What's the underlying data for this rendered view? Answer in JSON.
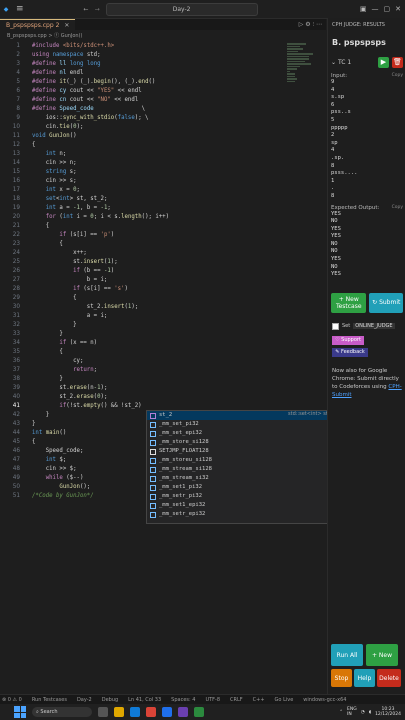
{
  "titlebar": {
    "search": "Day-2",
    "menu": "≡",
    "nav_back": "←",
    "nav_fwd": "→"
  },
  "tabs": [
    {
      "label": "B_pspspsps.cpp 2"
    }
  ],
  "breadcrumb": "B_pspspsps.cpp > ⓕ GunJon()",
  "code_lines": [
    {
      "n": "1",
      "html": "<span class='kw'>#include</span> <span class='st'>&lt;bits/stdc++.h&gt;</span>"
    },
    {
      "n": "2",
      "html": "<span class='kw'>using</span> <span class='ty'>namespace</span> std;"
    },
    {
      "n": "3",
      "html": "<span class='kw'>#define</span> <span class='mac'>ll</span> <span class='ty'>long long</span>"
    },
    {
      "n": "4",
      "html": "<span class='kw'>#define</span> <span class='mac'>nl</span> endl"
    },
    {
      "n": "5",
      "html": "<span class='kw'>#define</span> <span class='fn'>it</span>(_) (_).<span class='fn'>begin</span>(), (_).<span class='fn'>end</span>()"
    },
    {
      "n": "6",
      "html": "<span class='kw'>#define</span> <span class='mac'>cy</span> cout &lt;&lt; <span class='st'>\"YES\"</span> &lt;&lt; endl"
    },
    {
      "n": "7",
      "html": "<span class='kw'>#define</span> <span class='mac'>cn</span> cout &lt;&lt; <span class='st'>\"NO\"</span> &lt;&lt; endl"
    },
    {
      "n": "8",
      "html": "<span class='kw'>#define</span> <span class='mac'>Speed_code</span>              \\"
    },
    {
      "n": "9",
      "html": "    ios::<span class='fn'>sync_with_stdio</span>(<span class='ty'>false</span>); \\"
    },
    {
      "n": "10",
      "html": "    cin.<span class='fn'>tie</span>(<span class='nm'>0</span>);"
    },
    {
      "n": "11",
      "html": "<span class='ty'>void</span> <span class='fn'>GunJon</span>()"
    },
    {
      "n": "12",
      "html": "{"
    },
    {
      "n": "13",
      "html": "    <span class='ty'>int</span> n;"
    },
    {
      "n": "14",
      "html": "    cin &gt;&gt; n;"
    },
    {
      "n": "15",
      "html": "    <span class='ty'>string</span> s;"
    },
    {
      "n": "16",
      "html": "    cin &gt;&gt; s;"
    },
    {
      "n": "17",
      "html": "    <span class='ty'>int</span> x = <span class='nm'>0</span>;"
    },
    {
      "n": "18",
      "html": "    <span class='ty'>set</span>&lt;<span class='ty'>int</span>&gt; st, st_2;"
    },
    {
      "n": "19",
      "html": "    <span class='ty'>int</span> a = <span class='nm'>-1</span>, b = <span class='nm'>-1</span>;"
    },
    {
      "n": "20",
      "html": "    <span class='kw'>for</span> (<span class='ty'>int</span> i = <span class='nm'>0</span>; i &lt; s.<span class='fn'>length</span>(); i++)"
    },
    {
      "n": "21",
      "html": "    {"
    },
    {
      "n": "22",
      "html": "        <span class='kw'>if</span> (s[i] == <span class='st'>'p'</span>)"
    },
    {
      "n": "23",
      "html": "        {"
    },
    {
      "n": "24",
      "html": "            x++;"
    },
    {
      "n": "25",
      "html": "            st.<span class='fn'>insert</span>(<span class='nm'>1</span>);"
    },
    {
      "n": "26",
      "html": "            <span class='kw'>if</span> (b == <span class='nm'>-1</span>)"
    },
    {
      "n": "27",
      "html": "                b = i;"
    },
    {
      "n": "28",
      "html": "            <span class='kw'>if</span> (s[i] == <span class='st'>'s'</span>)"
    },
    {
      "n": "29",
      "html": "            {"
    },
    {
      "n": "30",
      "html": "                st_2.<span class='fn'>insert</span>(<span class='nm'>1</span>);"
    },
    {
      "n": "31",
      "html": "                a = i;"
    },
    {
      "n": "32",
      "html": "            }"
    },
    {
      "n": "33",
      "html": "        }"
    },
    {
      "n": "34",
      "html": "        <span class='kw'>if</span> (x == n)"
    },
    {
      "n": "35",
      "html": "        {"
    },
    {
      "n": "36",
      "html": "            cy;"
    },
    {
      "n": "37",
      "html": "            <span class='kw'>return</span>;"
    },
    {
      "n": "38",
      "html": "        }"
    },
    {
      "n": "39",
      "html": "        st.<span class='fn'>erase</span>(n<span class='nm'>-1</span>);"
    },
    {
      "n": "40",
      "html": "        st_2.<span class='fn'>erase</span>(<span class='nm'>0</span>);"
    },
    {
      "n": "41",
      "html": "        <span class='kw'>if</span>(!st.<span class='fn'>empty</span>() &amp;&amp; !st_2)"
    },
    {
      "n": "42",
      "html": "    }"
    },
    {
      "n": "43",
      "html": "}"
    },
    {
      "n": "44",
      "html": "<span class='ty'>int</span> <span class='fn'>main</span>()"
    },
    {
      "n": "45",
      "html": "{"
    },
    {
      "n": "46",
      "html": "    Speed_code;"
    },
    {
      "n": "47",
      "html": "    <span class='ty'>int</span> $;"
    },
    {
      "n": "48",
      "html": "    cin &gt;&gt; $;"
    },
    {
      "n": "49",
      "html": "    <span class='kw'>while</span> ($--)"
    },
    {
      "n": "50",
      "html": "        <span class='fn'>GunJon</span>();"
    },
    {
      "n": "51",
      "html": "<span class='cm'>/*Code by GunJon*/</span>"
    }
  ],
  "autocomplete": {
    "items": [
      "st_2",
      "_mm_set_pi32",
      "_mm_set_epi32",
      "_mm_store_si128",
      "SETJMP_FLOAT128",
      "_mm_storeu_si128",
      "_mm_stream_si128",
      "_mm_stream_si32",
      "_mm_set1_pi32",
      "_mm_setr_pi32",
      "_mm_set1_epi32",
      "_mm_setr_epi32"
    ],
    "detail": "std::set<int> st_2"
  },
  "panel": {
    "header": "CPH JUDGE: RESULTS",
    "problem": "B. pspspsps",
    "testcase": "TC 1",
    "input_label": "Input:",
    "copy": "Copy",
    "input": "9\n4\ns.sp\n6\npss..s\n5\nppppp\n2\nsp\n4\n.sp.\n8\npsss....\n1\n.\n8",
    "expected_label": "Expected Output:",
    "expected": "YES\nNO\nYES\nYES\nNO\nNO\nYES\nNO\nYES",
    "new_testcase": "+ New Testcase",
    "submit": "Submit",
    "set_online": "Set",
    "online_judge": "ONLINE_JUDGE",
    "support": "Support",
    "feedback": "Feedback",
    "promo": "Now also for Google Chrome: Submit directly to Codeforces using",
    "promo_link": "CPH-Submit",
    "run_all": "Run All",
    "new": "+ New",
    "stop": "Stop",
    "help": "Help",
    "delete": "Delete"
  },
  "statusbar": [
    "⊗ 0 ⚠ 0",
    "Run Testcases",
    "Day-2",
    "Debug",
    "Ln 41, Col 33",
    "Spaces: 4",
    "UTF-8",
    "CRLF",
    "C++",
    "Go Live",
    "windows-gcc-x64"
  ],
  "taskbar": {
    "search": "Search",
    "lang": "ENG\nIN",
    "time": "10:23\n12/12/2024"
  },
  "colors": {
    "accent": "#007acc",
    "run": "#2ea043",
    "delete": "#c42b1c",
    "teal": "#21a0b8"
  }
}
